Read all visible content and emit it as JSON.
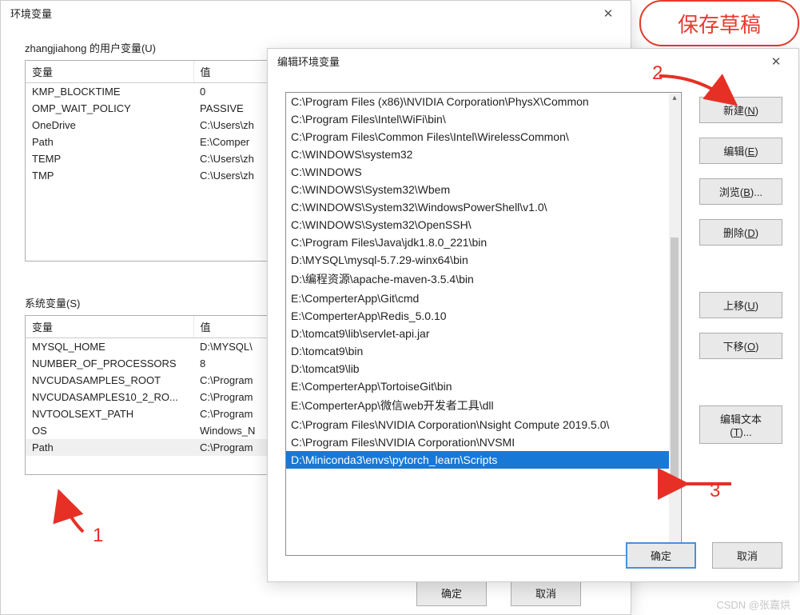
{
  "orange_button": "保存草稿",
  "dlg1": {
    "title": "环境变量",
    "user_section": "zhangjiahong 的用户变量(U)",
    "sys_section": "系统变量(S)",
    "col_var": "变量",
    "col_val": "值",
    "user_vars": [
      {
        "name": "KMP_BLOCKTIME",
        "value": "0"
      },
      {
        "name": "OMP_WAIT_POLICY",
        "value": "PASSIVE"
      },
      {
        "name": "OneDrive",
        "value": "C:\\Users\\zh"
      },
      {
        "name": "Path",
        "value": "E:\\Comper"
      },
      {
        "name": "TEMP",
        "value": "C:\\Users\\zh"
      },
      {
        "name": "TMP",
        "value": "C:\\Users\\zh"
      }
    ],
    "sys_vars": [
      {
        "name": "MYSQL_HOME",
        "value": "D:\\MYSQL\\"
      },
      {
        "name": "NUMBER_OF_PROCESSORS",
        "value": "8"
      },
      {
        "name": "NVCUDASAMPLES_ROOT",
        "value": "C:\\Program"
      },
      {
        "name": "NVCUDASAMPLES10_2_RO...",
        "value": "C:\\Program"
      },
      {
        "name": "NVTOOLSEXT_PATH",
        "value": "C:\\Program"
      },
      {
        "name": "OS",
        "value": "Windows_N"
      },
      {
        "name": "Path",
        "value": "C:\\Program",
        "selected": true
      }
    ],
    "ok": "确定",
    "cancel": "取消"
  },
  "dlg2": {
    "title": "编辑环境变量",
    "paths": [
      "C:\\Program Files (x86)\\NVIDIA Corporation\\PhysX\\Common",
      "C:\\Program Files\\Intel\\WiFi\\bin\\",
      "C:\\Program Files\\Common Files\\Intel\\WirelessCommon\\",
      "C:\\WINDOWS\\system32",
      "C:\\WINDOWS",
      "C:\\WINDOWS\\System32\\Wbem",
      "C:\\WINDOWS\\System32\\WindowsPowerShell\\v1.0\\",
      "C:\\WINDOWS\\System32\\OpenSSH\\",
      "C:\\Program Files\\Java\\jdk1.8.0_221\\bin",
      "D:\\MYSQL\\mysql-5.7.29-winx64\\bin",
      "D:\\编程资源\\apache-maven-3.5.4\\bin",
      "E:\\ComperterApp\\Git\\cmd",
      "E:\\ComperterApp\\Redis_5.0.10",
      "D:\\tomcat9\\lib\\servlet-api.jar",
      "D:\\tomcat9\\bin",
      "D:\\tomcat9\\lib",
      "E:\\ComperterApp\\TortoiseGit\\bin",
      "E:\\ComperterApp\\微信web开发者工具\\dll",
      "C:\\Program Files\\NVIDIA Corporation\\Nsight Compute 2019.5.0\\",
      "C:\\Program Files\\NVIDIA Corporation\\NVSMI",
      "D:\\Miniconda3\\envs\\pytorch_learn\\Scripts"
    ],
    "selected_index": 20,
    "buttons": {
      "new": {
        "label": "新建",
        "accel": "N"
      },
      "edit": {
        "label": "编辑",
        "accel": "E"
      },
      "browse": {
        "label": "浏览",
        "accel": "B",
        "suffix": "..."
      },
      "delete": {
        "label": "删除",
        "accel": "D"
      },
      "up": {
        "label": "上移",
        "accel": "U"
      },
      "down": {
        "label": "下移",
        "accel": "O"
      },
      "edit_text": {
        "label": "编辑文本",
        "accel": "T",
        "suffix": "..."
      }
    },
    "ok": "确定",
    "cancel": "取消"
  },
  "annotations": {
    "n1": "1",
    "n2": "2",
    "n3": "3"
  },
  "watermark": "CSDN @张嘉烘"
}
